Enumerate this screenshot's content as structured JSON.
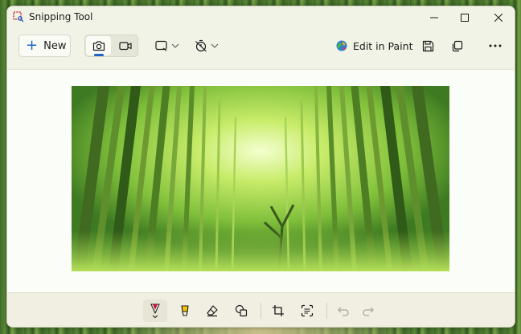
{
  "window": {
    "title": "Snipping Tool"
  },
  "toolbar": {
    "new_label": "New",
    "edit_in_paint_label": "Edit in Paint"
  },
  "icons": {
    "app": "snipping-tool-icon",
    "minimize": "minimize-icon",
    "maximize": "maximize-icon",
    "close": "close-icon",
    "new": "plus-icon",
    "screenshot_mode": "camera-icon",
    "video_mode": "video-camera-icon",
    "snip_shape": "rectangle-snip-icon",
    "delay": "timer-off-icon",
    "paint": "paint-globe-icon",
    "save": "save-icon",
    "copy": "copy-icon",
    "more": "more-icon",
    "pen": "ballpoint-pen-icon",
    "highlighter": "highlighter-icon",
    "eraser": "eraser-icon",
    "shapes": "shapes-icon",
    "crop": "crop-icon",
    "text_actions": "text-actions-icon",
    "undo": "undo-icon",
    "redo": "redo-icon"
  },
  "colors": {
    "accent": "#1e64c8",
    "pen": "#c8102e",
    "highlighter": "#f2c500"
  },
  "state": {
    "active_mode": "screenshot",
    "active_tool": "pen"
  }
}
